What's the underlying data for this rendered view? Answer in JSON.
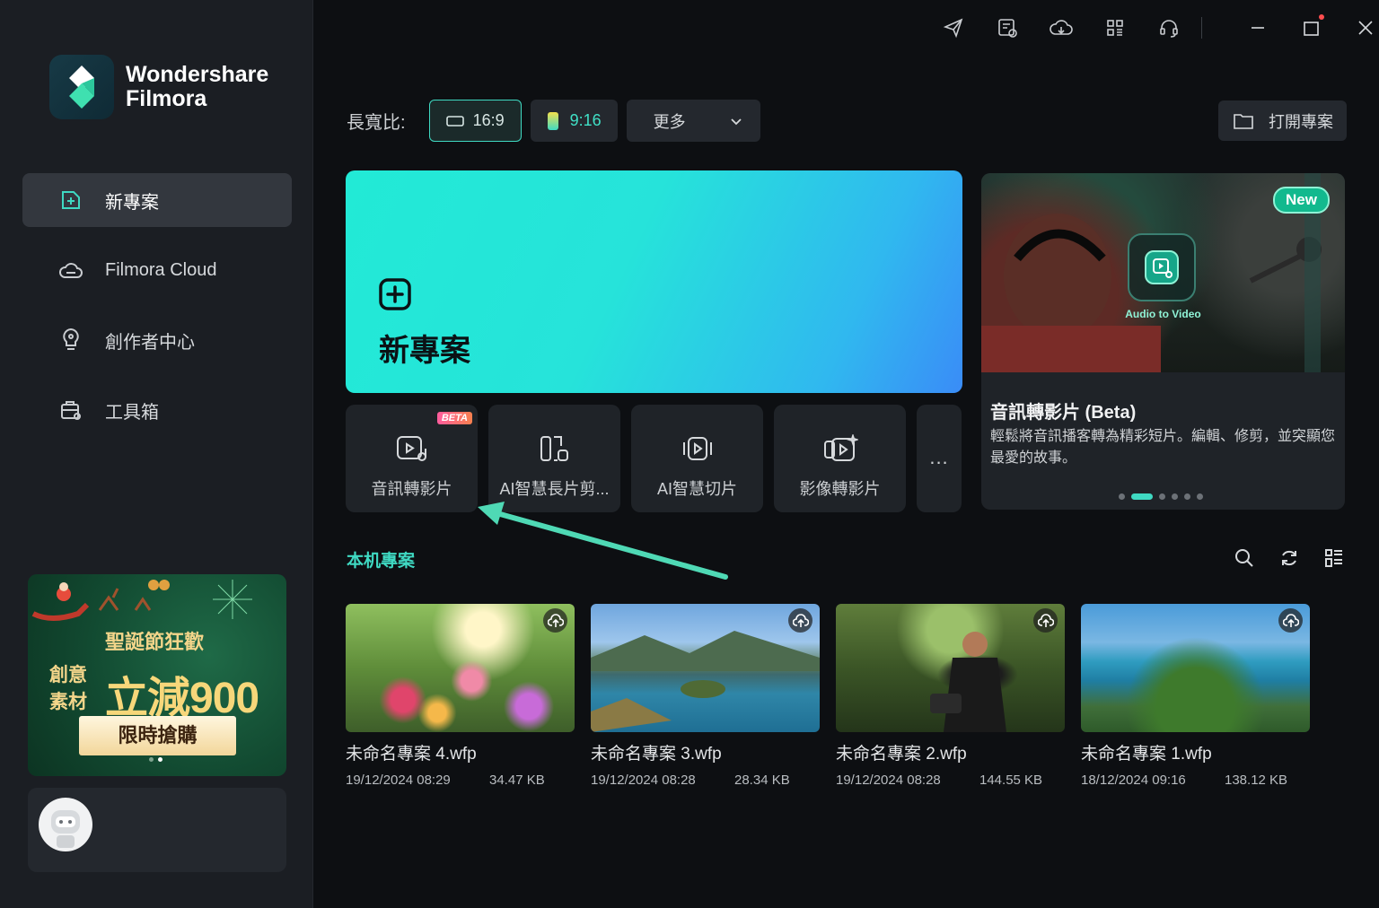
{
  "app": {
    "brand_line1": "Wondershare",
    "brand_line2": "Filmora"
  },
  "sidebar": {
    "items": [
      {
        "label": "新專案",
        "icon": "new-project-icon",
        "active": true
      },
      {
        "label": "Filmora Cloud",
        "icon": "cloud-icon",
        "active": false
      },
      {
        "label": "創作者中心",
        "icon": "lightbulb-icon",
        "active": false
      },
      {
        "label": "工具箱",
        "icon": "toolbox-icon",
        "active": false
      }
    ],
    "promo": {
      "title": "聖誕節狂歡",
      "side_text": "創意素材",
      "big_text": "立減900",
      "button": "限時搶購"
    }
  },
  "toolbar": {
    "icons": [
      "send-feedback-icon",
      "schedule-icon",
      "cloud-sync-icon",
      "apps-grid-icon",
      "headset-icon"
    ],
    "window": [
      "minimize-icon",
      "maximize-icon",
      "close-icon"
    ],
    "notification_color": "#ff4d4f"
  },
  "aspect": {
    "label": "長寬比:",
    "options": [
      "16:9",
      "9:16"
    ],
    "selected": "16:9",
    "more": "更多"
  },
  "open_project": "打開專案",
  "hero": {
    "label": "新專案"
  },
  "tools": [
    {
      "label": "音訊轉影片",
      "badge": "BETA",
      "icon": "audio-to-video-icon"
    },
    {
      "label": "AI智慧長片剪...",
      "icon": "ai-long-video-cut-icon"
    },
    {
      "label": "AI智慧切片",
      "icon": "ai-slice-icon"
    },
    {
      "label": "影像轉影片",
      "icon": "image-to-video-icon"
    },
    {
      "label": "...",
      "icon": "more-icon"
    }
  ],
  "feature": {
    "badge": "New",
    "chip_label": "Audio to Video",
    "title": "音訊轉影片 (Beta)",
    "description": "輕鬆將音訊播客轉為精彩短片。編輯、修剪，並突顯您最愛的故事。",
    "pages": 6,
    "current_page": 2
  },
  "local": {
    "title": "本机專案",
    "tools": [
      "search-icon",
      "refresh-icon",
      "list-view-icon"
    ]
  },
  "projects": [
    {
      "name": "未命名專案 4.wfp",
      "date": "19/12/2024 08:29",
      "size": "34.47 KB"
    },
    {
      "name": "未命名專案 3.wfp",
      "date": "19/12/2024 08:28",
      "size": "28.34 KB"
    },
    {
      "name": "未命名專案 2.wfp",
      "date": "19/12/2024 08:28",
      "size": "144.55 KB"
    },
    {
      "name": "未命名專案 1.wfp",
      "date": "18/12/2024 09:16",
      "size": "138.12 KB"
    }
  ],
  "colors": {
    "accent": "#3fd9c2",
    "background": "#0d0f12",
    "sidebar": "#1b1e23",
    "annotation_arrow": "#4fd9b5"
  }
}
